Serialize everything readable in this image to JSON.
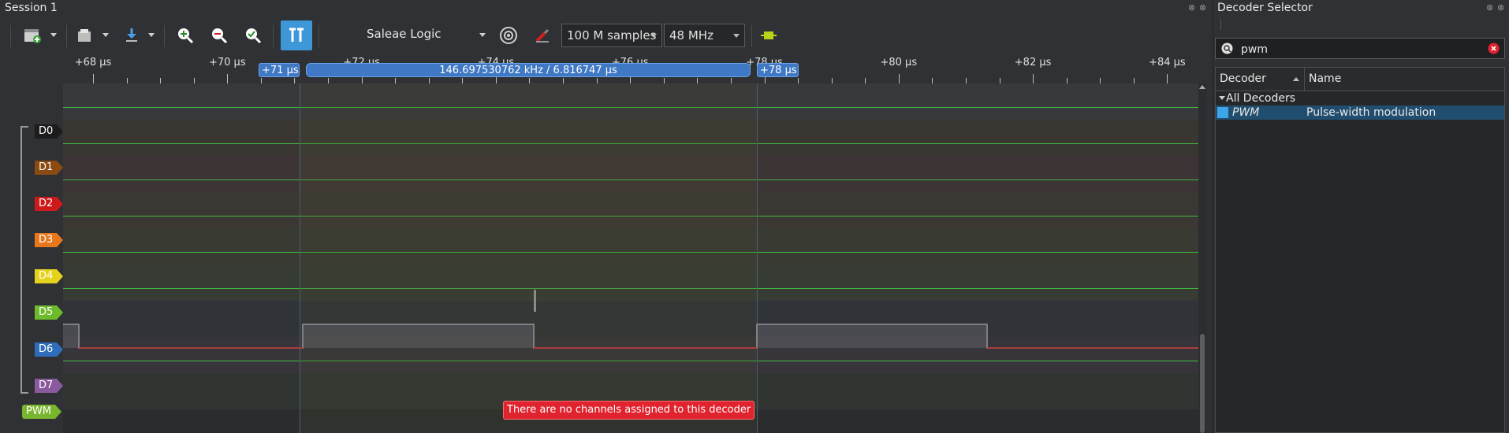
{
  "session": {
    "title": "Session 1"
  },
  "toolbar": {
    "device": "Saleae Logic",
    "samples": "100 M samples",
    "rate": "48 MHz"
  },
  "ruler": {
    "ticks": [
      "+68 µs",
      "+70 µs",
      "+72 µs",
      "+74 µs",
      "+76 µs",
      "+78 µs",
      "+80 µs",
      "+82 µs",
      "+84 µs"
    ],
    "marker_left": "+71 µs",
    "measurement": "146.697530762 kHz / 6.816747 µs",
    "marker_right": "+78 µs"
  },
  "channels": [
    {
      "label": "D0",
      "color": "#1c1c1c"
    },
    {
      "label": "D1",
      "color": "#8a4a12"
    },
    {
      "label": "D2",
      "color": "#cc1a1a"
    },
    {
      "label": "D3",
      "color": "#e8771c"
    },
    {
      "label": "D4",
      "color": "#e6d21a"
    },
    {
      "label": "D5",
      "color": "#6dbb2a"
    },
    {
      "label": "D6",
      "color": "#2f6dba"
    },
    {
      "label": "D7",
      "color": "#8a5a9e"
    },
    {
      "label": "PWM",
      "color": "#79b52e"
    }
  ],
  "error_banner": "There are no channels assigned to this decoder",
  "decoder_panel": {
    "title": "Decoder Selector",
    "search_value": "pwm",
    "columns": {
      "decoder": "Decoder",
      "name": "Name"
    },
    "group": "All Decoders",
    "rows": [
      {
        "decoder": "PWM",
        "name": "Pulse-width modulation"
      }
    ]
  }
}
